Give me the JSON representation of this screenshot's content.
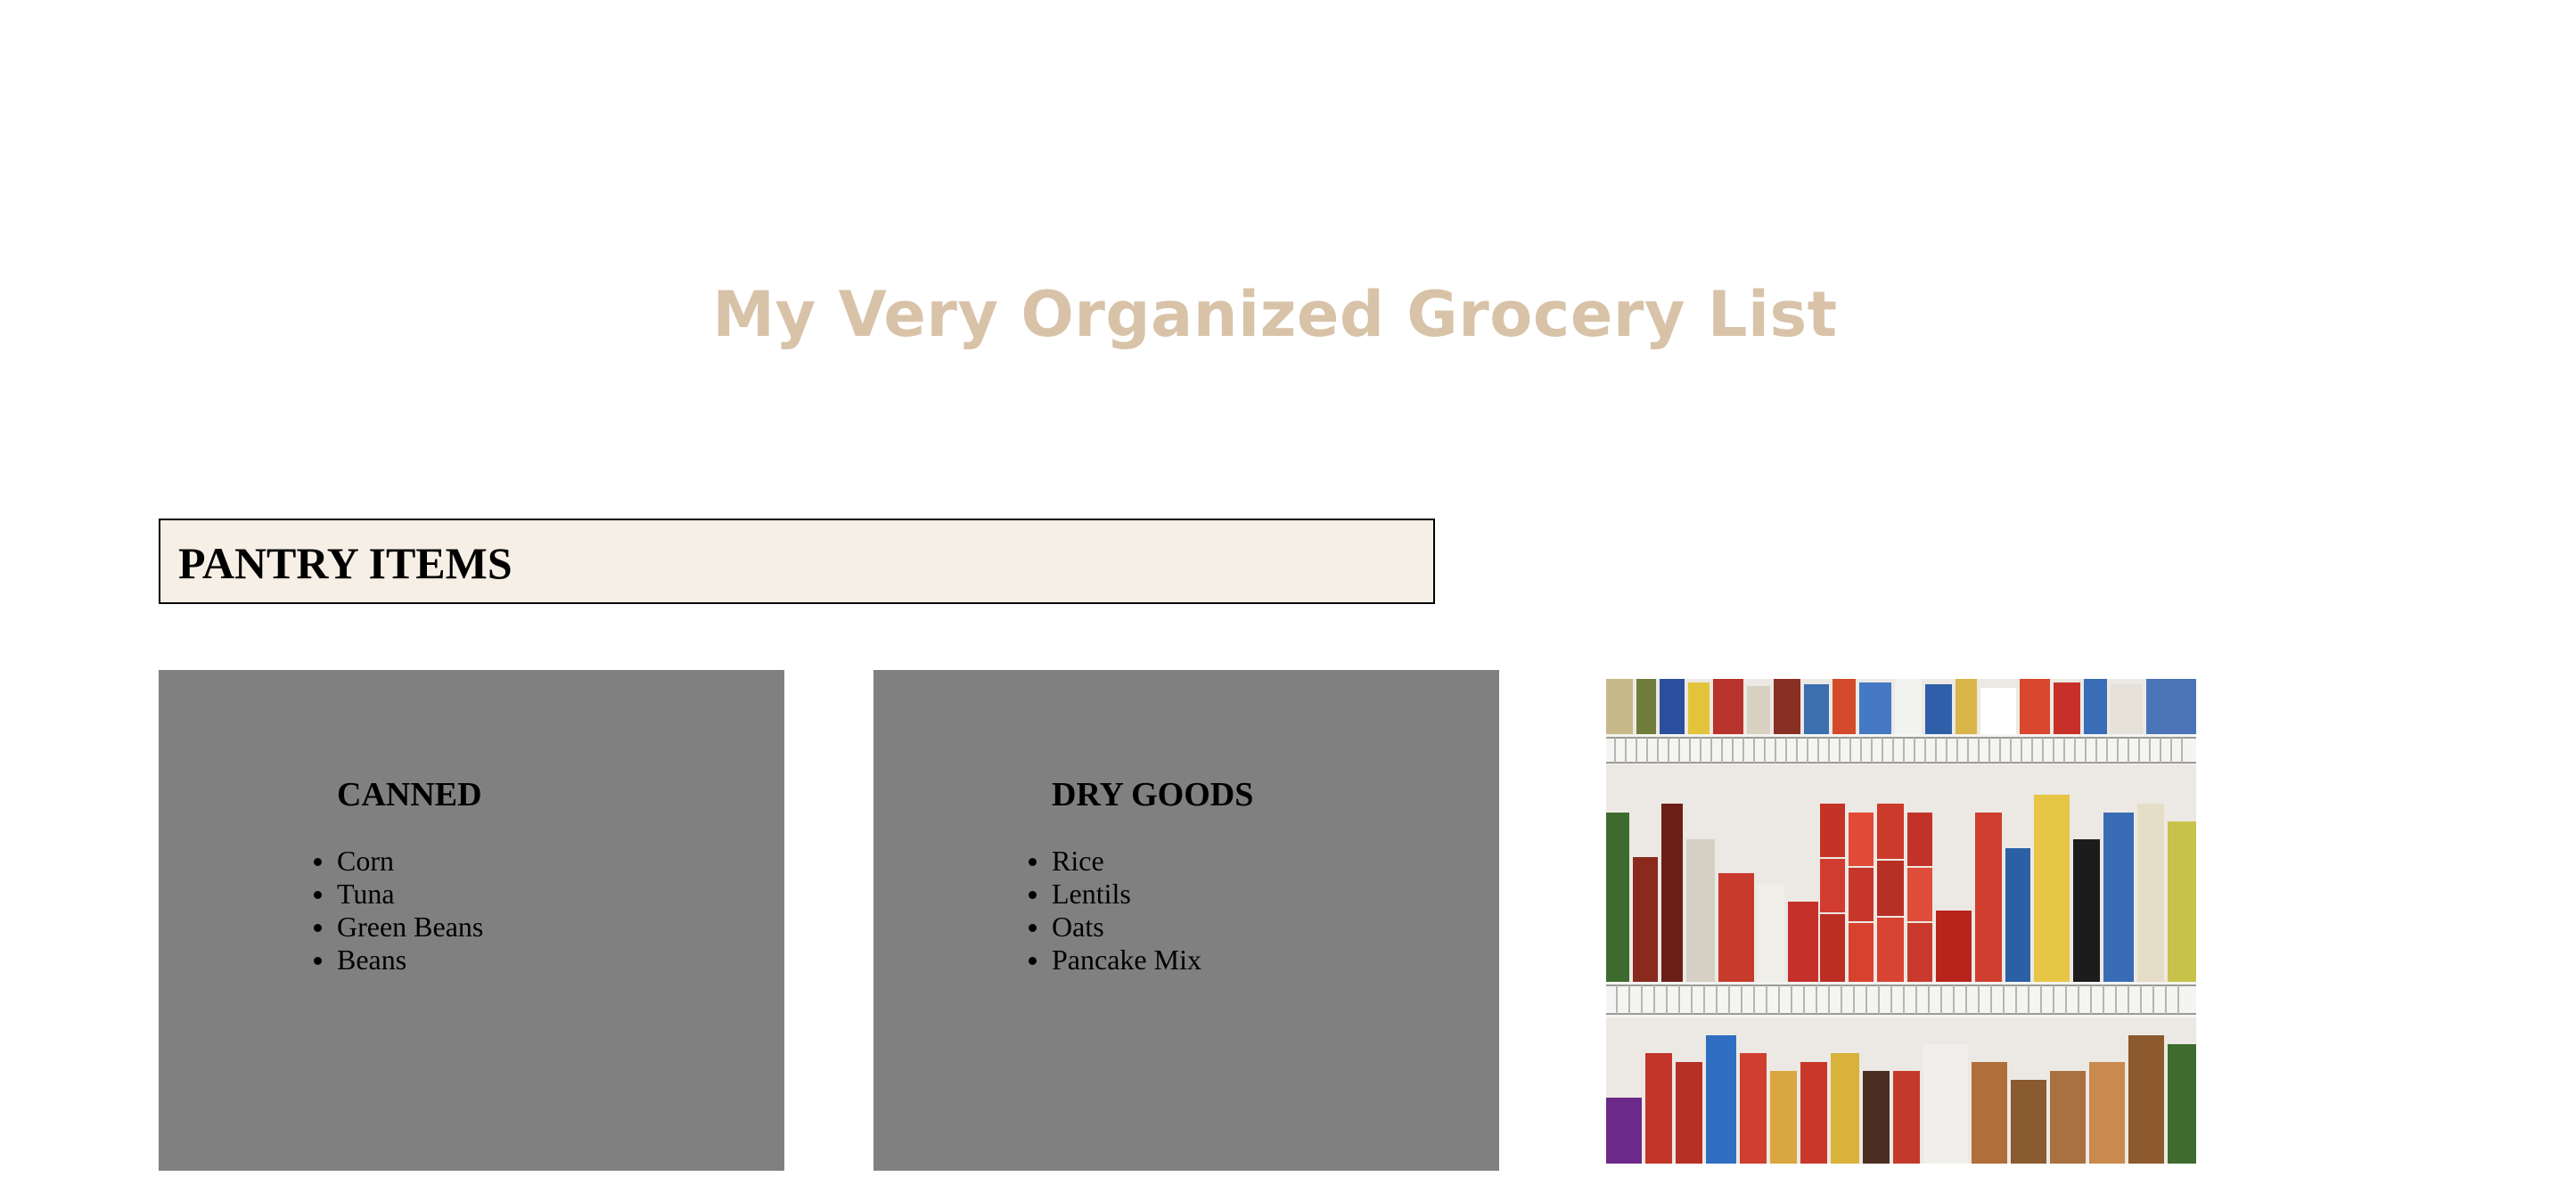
{
  "page": {
    "title": "My Very Organized Grocery List",
    "title_color": "#d8c3a9"
  },
  "section": {
    "heading": "PANTRY ITEMS",
    "background": "#f5efe6"
  },
  "cards": {
    "canned": {
      "heading": "CANNED",
      "items": [
        "Corn",
        "Tuna",
        "Green Beans",
        "Beans"
      ]
    },
    "dry_goods": {
      "heading": "DRY GOODS",
      "items": [
        "Rice",
        "Lentils",
        "Oats",
        "Pancake Mix"
      ]
    },
    "background": "#808080"
  },
  "image": {
    "subject": "pantry-shelves-photo"
  }
}
